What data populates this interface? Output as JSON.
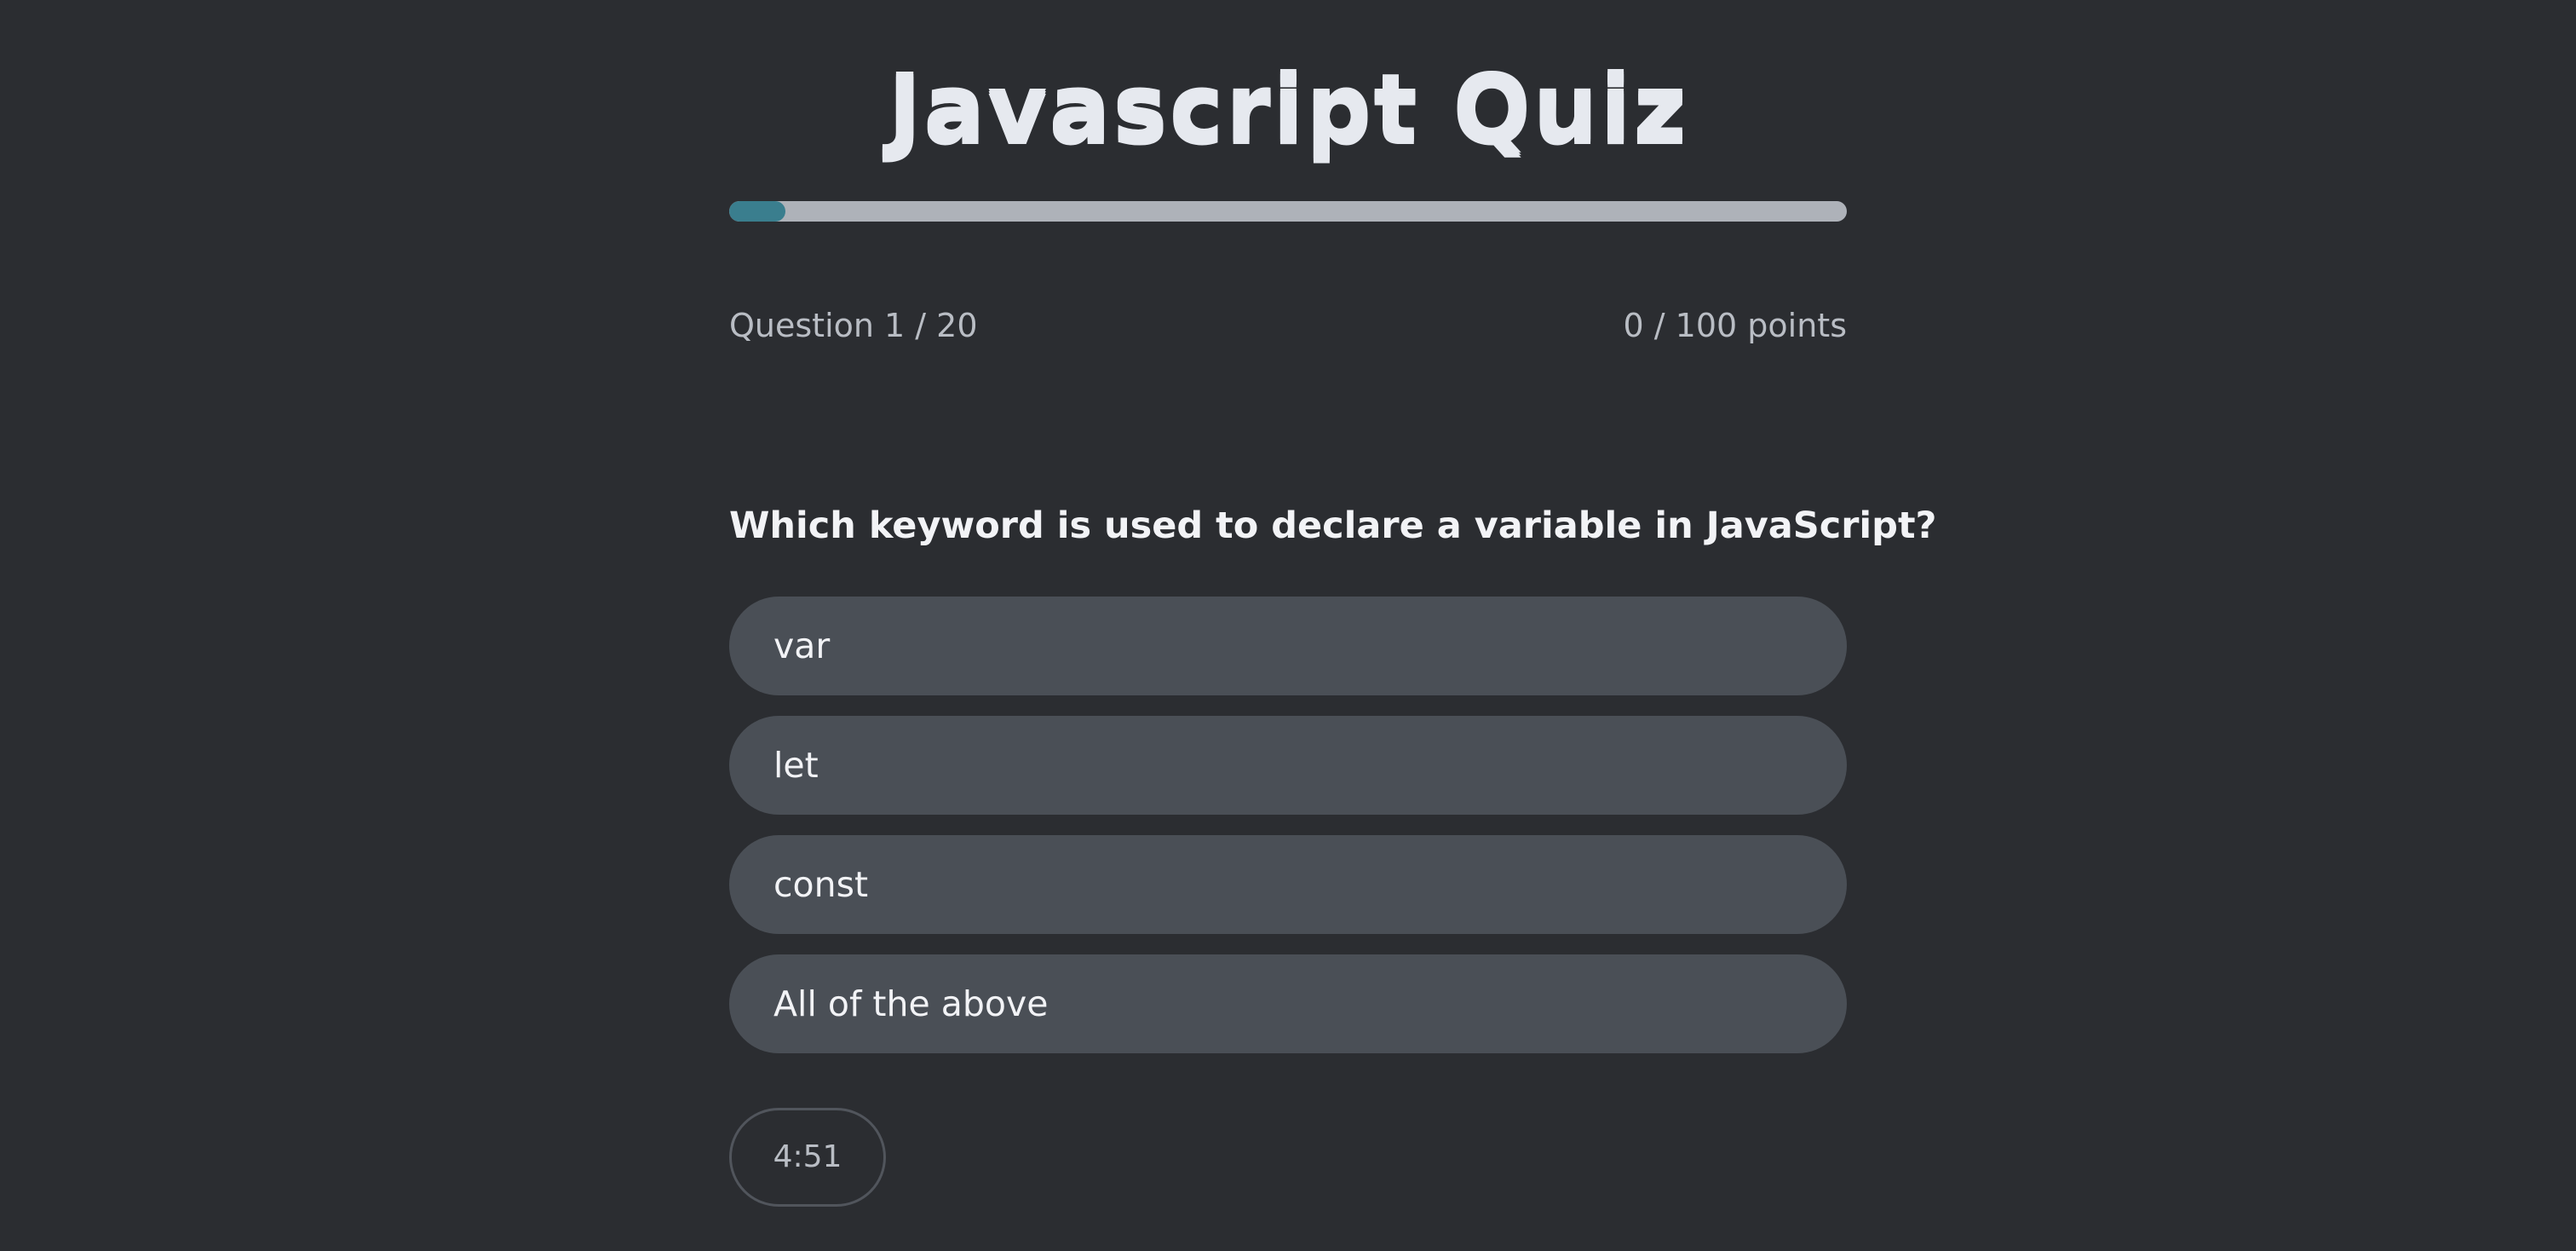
{
  "quiz": {
    "title": "Javascript Quiz",
    "progress_fraction": 0.05,
    "question_counter": "Question 1 / 20",
    "points": "0 / 100 points",
    "question_text": "Which keyword is used to declare a variable in JavaScript?",
    "answers": [
      {
        "label": "var"
      },
      {
        "label": "let"
      },
      {
        "label": "const"
      },
      {
        "label": "All of the above"
      }
    ],
    "timer": "4:51"
  },
  "colors": {
    "background": "#2b2d31",
    "progress_fill": "#3a7e8e",
    "progress_track": "#aeb2b9",
    "answer_bg": "#4a4f56"
  }
}
